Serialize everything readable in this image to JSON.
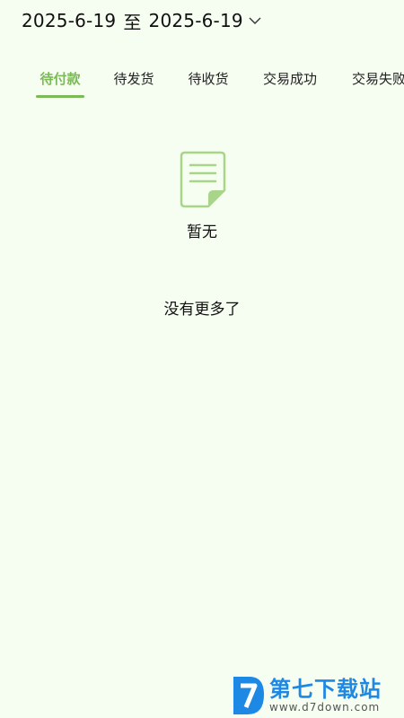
{
  "filter": {
    "start_date": "2025-6-19",
    "separator": "至",
    "end_date": "2025-6-19"
  },
  "tabs": [
    {
      "label": "待付款",
      "active": true
    },
    {
      "label": "待发货",
      "active": false
    },
    {
      "label": "待收货",
      "active": false
    },
    {
      "label": "交易成功",
      "active": false
    },
    {
      "label": "交易失败",
      "active": false
    }
  ],
  "empty_state": {
    "text": "暂无",
    "icon": "document-icon"
  },
  "list_footer": {
    "text": "没有更多了"
  },
  "watermark": {
    "title": "第七下载站",
    "url": "www.d7down.com"
  },
  "colors": {
    "accent": "#7cb957",
    "background": "#f6fdf1",
    "watermark": "#1e88e5"
  }
}
